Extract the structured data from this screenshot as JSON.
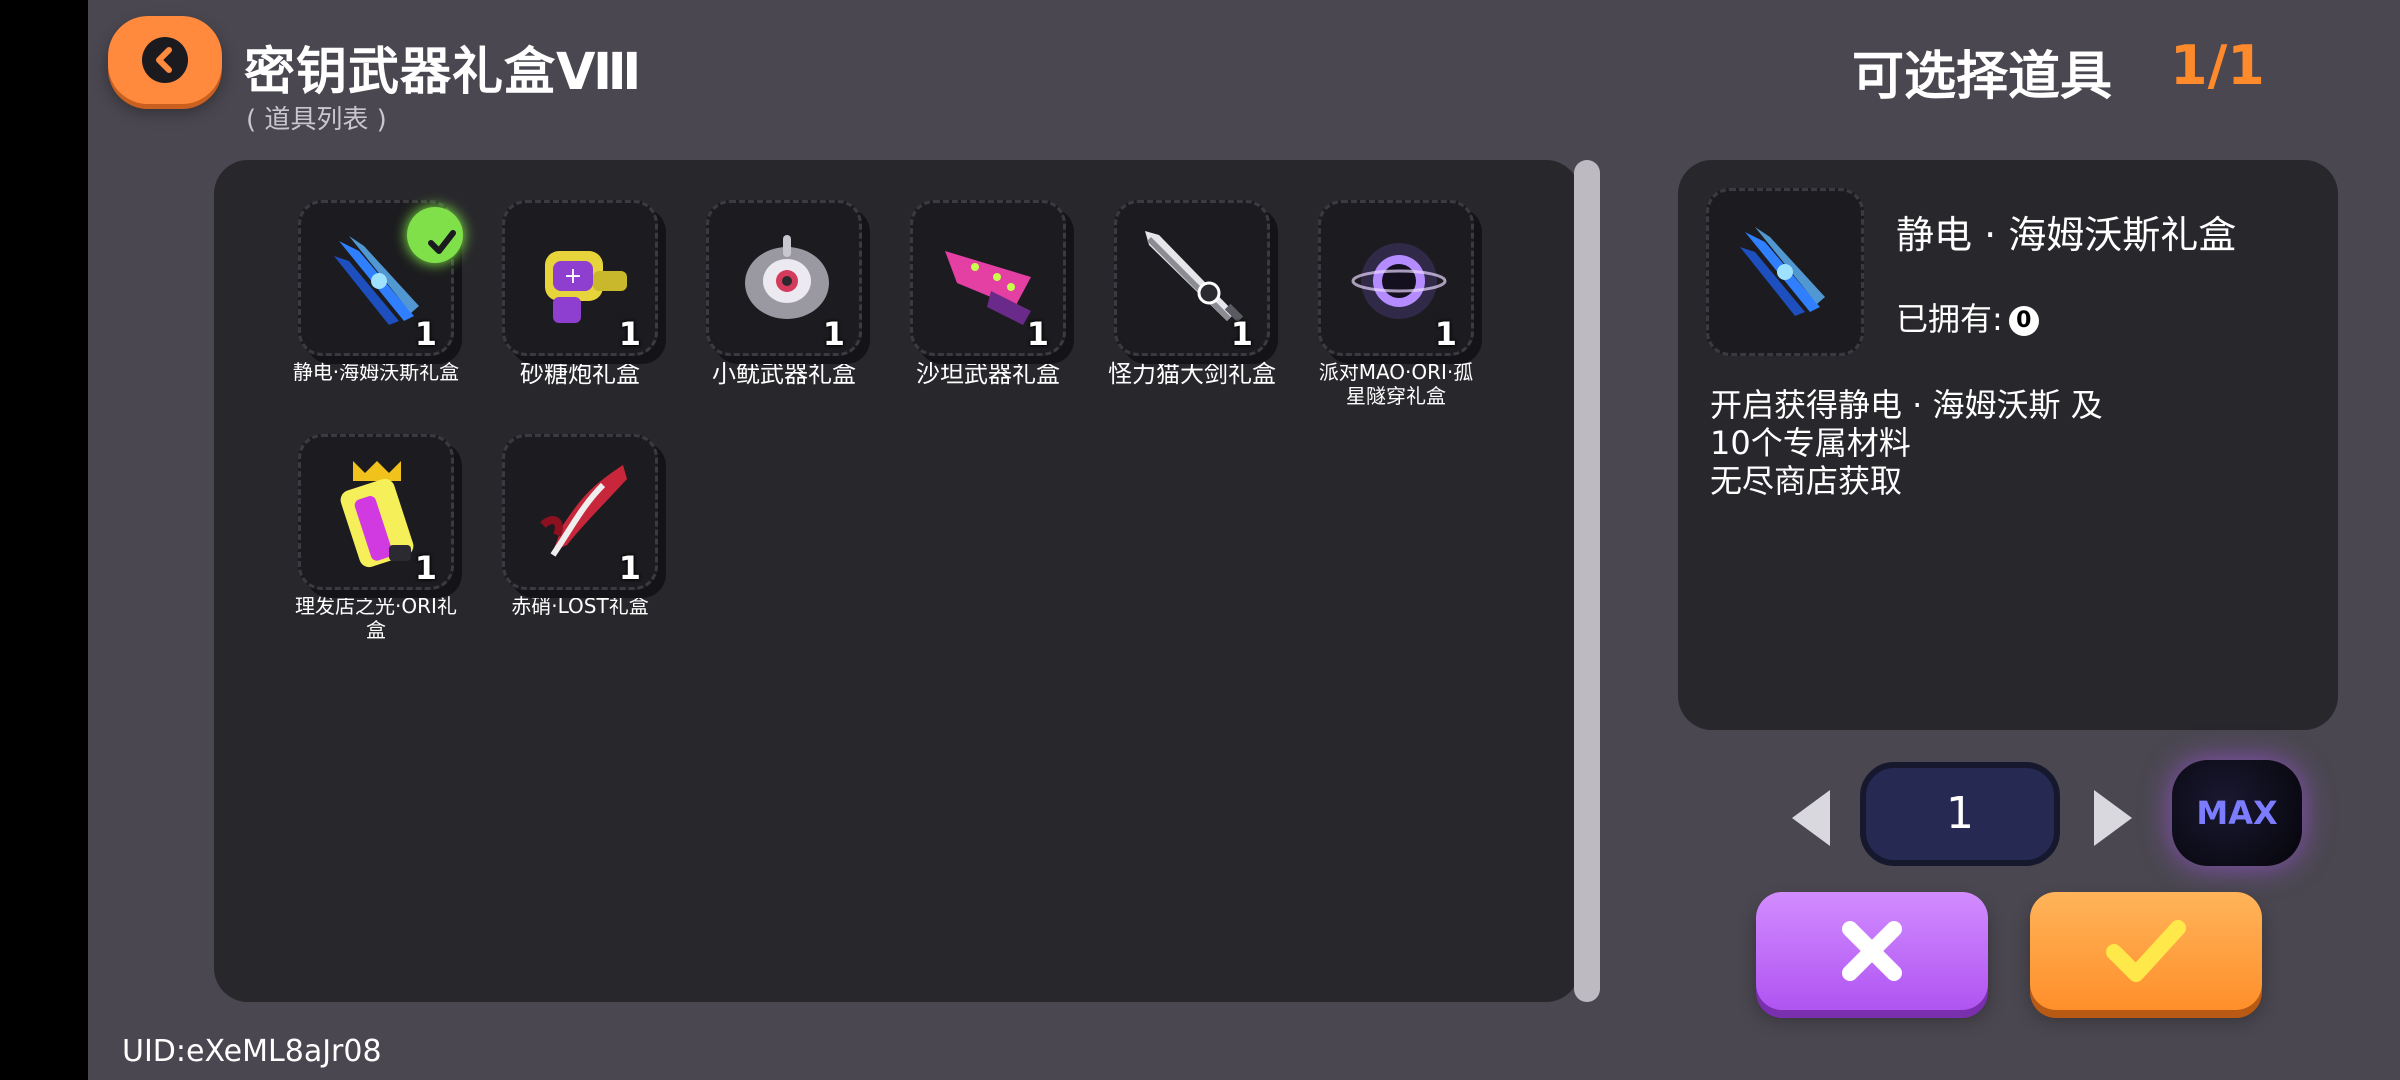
{
  "header": {
    "title": "密钥武器礼盒Ⅷ",
    "subtitle": "( 道具列表 )",
    "selectable_label": "可选择道具",
    "selectable_count": "1/1"
  },
  "items": [
    {
      "name": "静电·海姆沃斯礼盒",
      "qty": "1",
      "selected": true
    },
    {
      "name": "砂糖炮礼盒",
      "qty": "1"
    },
    {
      "name": "小鱿武器礼盒",
      "qty": "1"
    },
    {
      "name": "沙坦武器礼盒",
      "qty": "1"
    },
    {
      "name": "怪力猫大剑礼盒",
      "qty": "1"
    },
    {
      "name": "派对MAO·ORI·孤星隧穿礼盒",
      "qty": "1"
    },
    {
      "name": "理发店之光·ORI礼盒",
      "qty": "1"
    },
    {
      "name": "赤硝·LOST礼盒",
      "qty": "1"
    }
  ],
  "detail": {
    "name": "静电 · 海姆沃斯礼盒",
    "owned_label": "已拥有:",
    "owned_value": "0",
    "description_lines": [
      "开启获得静电 · 海姆沃斯 及",
      "10个专属材料",
      "无尽商店获取"
    ]
  },
  "controls": {
    "quantity": "1",
    "max_label": "MAX"
  },
  "footer": {
    "uid": "UID:eXeML8aJr08"
  },
  "colors": {
    "accent_orange": "#ff8a2b",
    "cancel_purple": "#b054f2",
    "selected_green": "#7fe04a"
  },
  "icons": [
    "back-arrow-icon",
    "checkmark-icon",
    "arrow-left-icon",
    "arrow-right-icon",
    "close-icon",
    "confirm-check-icon"
  ]
}
